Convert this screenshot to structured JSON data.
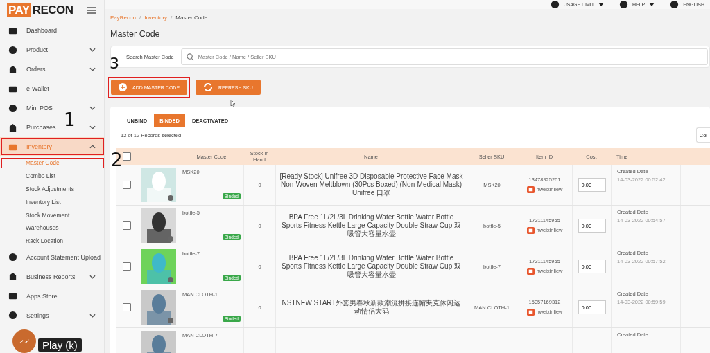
{
  "logo": {
    "part1": "PAY",
    "part2": "RECON"
  },
  "topbar": {
    "items": [
      {
        "label": "USAGE LIMIT",
        "dropdown": true
      },
      {
        "label": "HELP",
        "dropdown": true
      },
      {
        "label": "ENGLISH",
        "dropdown": false
      }
    ]
  },
  "sidebar": {
    "items": [
      {
        "label": "Dashboard",
        "selected": false
      },
      {
        "label": "Product",
        "expanded": false,
        "selected": false
      },
      {
        "label": "Orders",
        "expanded": false,
        "selected": false
      },
      {
        "label": "e-Wallet",
        "selected": false
      },
      {
        "label": "Mini POS",
        "expanded": false,
        "selected": false
      },
      {
        "label": "Purchases",
        "expanded": false,
        "selected": false
      },
      {
        "label": "Inventory",
        "expanded": true,
        "selected": true,
        "annotation": "1",
        "children": [
          {
            "label": "Master Code",
            "selected": true,
            "annotation": "2"
          },
          {
            "label": "Combo List",
            "selected": false
          },
          {
            "label": "Stock Adjustments",
            "selected": false
          },
          {
            "label": "Inventory List",
            "selected": false
          },
          {
            "label": "Stock Movement",
            "selected": false
          },
          {
            "label": "Warehouses",
            "selected": false
          },
          {
            "label": "Rack Location",
            "selected": false
          }
        ]
      },
      {
        "label": "Account Statement Upload",
        "selected": false
      },
      {
        "label": "Business Reports",
        "expanded": false,
        "selected": false
      },
      {
        "label": "Apps Store",
        "selected": false
      },
      {
        "label": "Settings",
        "expanded": false,
        "selected": false
      }
    ]
  },
  "breadcrumb": [
    {
      "label": "PayRecon",
      "kind": "link"
    },
    {
      "label": "/",
      "kind": "separator"
    },
    {
      "label": "Inventory",
      "kind": "link"
    },
    {
      "label": "/",
      "kind": "separator"
    },
    {
      "label": "Master Code",
      "kind": "current"
    }
  ],
  "page_title": "Master Code",
  "search": {
    "label": "Search Master Code",
    "placeholder": "Master Code / Name / Seller SKU"
  },
  "actions": [
    {
      "label": "ADD MASTER CODE",
      "kind": "add",
      "annotation": "3"
    },
    {
      "label": "REFRESH SKU",
      "kind": "refresh"
    }
  ],
  "tabs": [
    {
      "label": "UNBIND",
      "selected": false
    },
    {
      "label": "BINDED",
      "selected": true
    },
    {
      "label": "DEACTIVATED",
      "selected": false
    }
  ],
  "records": "12 of 12 Records selected",
  "columns_button": "Col",
  "table": {
    "select_all_checked": false,
    "columns": [
      "Master Code",
      "Stock in Hand",
      "Name",
      "Seller SKU",
      "Item ID",
      "Cost",
      "Time"
    ],
    "rows": [
      {
        "checked": false,
        "master_code": "MSK20",
        "status": "Binded",
        "stock": "0",
        "name": "[Ready Stock] Unifree 3D Disposable Protective Face Mask Non-Woven Meltblown (30Pcs Boxed) (Non-Medical Mask) Unifree 口罩",
        "seller_sku": "MSK20",
        "item_id": "13478925261",
        "shop": "hweixinliew",
        "cost": "0.00",
        "time_label": "Created Date",
        "time": "14-03-2022 00:52:42"
      },
      {
        "checked": false,
        "master_code": "bottle-5",
        "status": "Binded",
        "stock": "0",
        "name": "BPA Free 1L/2L/3L Drinking Water Bottle Water Bottle Sports Fitness Kettle Large Capacity Double Straw Cup 双吸管大容量水壶",
        "seller_sku": "bottle-5",
        "item_id": "17311145955",
        "shop": "hweixinliew",
        "cost": "0.00",
        "time_label": "Created Date",
        "time": "14-03-2022 00:54:57"
      },
      {
        "checked": false,
        "master_code": "bottle-7",
        "status": "Binded",
        "stock": "0",
        "name": "BPA Free 1L/2L/3L Drinking Water Bottle Water Bottle Sports Fitness Kettle Large Capacity Double Straw Cup 双吸管大容量水壶",
        "seller_sku": "bottle-7",
        "item_id": "17311145955",
        "shop": "hweixinliew",
        "cost": "0.00",
        "time_label": "Created Date",
        "time": "14-03-2022 00:57:52"
      },
      {
        "checked": false,
        "master_code": "MAN CLOTH-1",
        "status": "Binded",
        "stock": "0",
        "name": "NSTNEW START外套男春秋新款潮流拼接连帽夹克休闲运动情侣大码",
        "seller_sku": "MAN CLOTH-1",
        "item_id": "15057169312",
        "shop": "hweixinliew",
        "cost": "0.00",
        "time_label": "Created Date",
        "time": "14-03-2022 00:59:59"
      },
      {
        "master_code": "MAN CLOTH-7",
        "time_label": "Created Date"
      }
    ]
  },
  "video_tooltip": "Play (k)"
}
